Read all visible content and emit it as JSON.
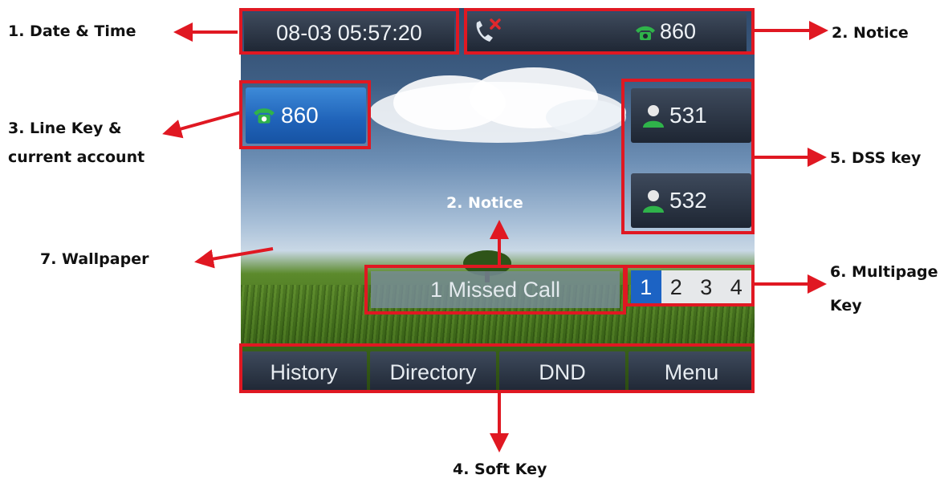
{
  "screen": {
    "datetime": "08-03 05:57:20",
    "notice_bar": {
      "account": "860",
      "missed_icon": "missed-call-icon",
      "phone_icon": "phone-icon"
    },
    "line_key": {
      "label": "860",
      "icon": "phone-icon"
    },
    "dss_keys": [
      {
        "label": "531",
        "icon": "contact-icon"
      },
      {
        "label": "532",
        "icon": "contact-icon"
      }
    ],
    "missed_call": "1 Missed Call",
    "pages": [
      {
        "num": "1",
        "active": true
      },
      {
        "num": "2",
        "active": false
      },
      {
        "num": "3",
        "active": false
      },
      {
        "num": "4",
        "active": false
      }
    ],
    "softkeys": [
      "History",
      "Directory",
      "DND",
      "Menu"
    ]
  },
  "callouts": {
    "date_time": "1. Date & Time",
    "notice": "2. Notice",
    "notice_center": "2. Notice",
    "line_key_1": "3. Line Key &",
    "line_key_2": "current account",
    "soft_key": "4. Soft Key",
    "dss_key": "5. DSS key",
    "multipage_1": "6. Multipage",
    "multipage_2": "Key",
    "wallpaper": "7. Wallpaper"
  },
  "colors": {
    "annotation": "#e01822",
    "line_key": "#1f62b8",
    "active_page": "#1c63c4",
    "phone_icon": "#2fb34a"
  }
}
